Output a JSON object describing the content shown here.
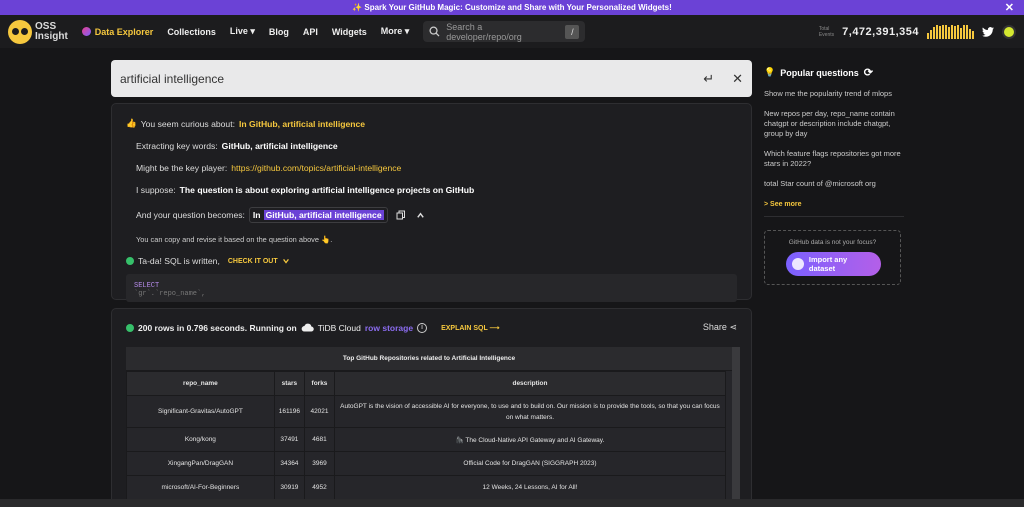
{
  "banner": {
    "text": "✨ Spark Your GitHub Magic: Customize and Share with Your Personalized Widgets!",
    "close": "✕"
  },
  "nav": {
    "logo_line1": "OSS",
    "logo_line2": "Insight",
    "items": [
      "Data Explorer",
      "Collections",
      "Live ▾",
      "Blog",
      "API",
      "Widgets",
      "More ▾"
    ],
    "search_placeholder": "Search a developer/repo/org",
    "search_shortcut": "/",
    "total_label_1": "Total",
    "total_label_2": "Events",
    "total_events": "7,472,391,354"
  },
  "query": {
    "text": "artificial intelligence",
    "enter": "↵",
    "clear": "✕"
  },
  "analysis": {
    "curious_prefix": "You seem curious about:",
    "curious_value": "In GitHub, artificial intelligence",
    "keywords_label": "Extracting key words:",
    "keywords_value": "GitHub, artificial intelligence",
    "player_label": "Might be the key player:",
    "player_value": "https://github.com/topics/artificial-intelligence",
    "suppose_label": "I suppose:",
    "suppose_value": "The question is about exploring artificial intelligence projects on GitHub",
    "becomes_label": "And your question becomes:",
    "becomes_in": "In",
    "becomes_value": "GitHub, artificial intelligence",
    "copy_hint": "You can copy and revise it based on the question above 👆.",
    "sql_written": "Ta-da! SQL is written,",
    "check_it_out": "CHECK IT OUT",
    "sql_line1": "SELECT",
    "sql_line2": "`gr`.`repo_name`,"
  },
  "result": {
    "summary": "200 rows in 0.796 seconds. Running on",
    "engine": "TiDB Cloud",
    "storage": "row storage",
    "explain": "EXPLAIN SQL ⟶",
    "share": "Share",
    "table_title": "Top GitHub Repositories related to Artificial Intelligence",
    "columns": [
      "repo_name",
      "stars",
      "forks",
      "description"
    ],
    "rows": [
      [
        "Significant-Gravitas/AutoGPT",
        "161196",
        "42021",
        "AutoGPT is the vision of accessible AI for everyone, to use and to build on. Our mission is to provide the tools, so that you can focus on what matters."
      ],
      [
        "Kong/kong",
        "37491",
        "4681",
        "🦍 The Cloud-Native API Gateway and AI Gateway."
      ],
      [
        "XingangPan/DragGAN",
        "34364",
        "3969",
        "Official Code for DragGAN (SIGGRAPH 2023)"
      ],
      [
        "microsoft/AI-For-Beginners",
        "30919",
        "4952",
        "12 Weeks, 24 Lessons, AI for All!"
      ]
    ]
  },
  "sidebar": {
    "title": "Popular questions",
    "questions": [
      "Show me the popularity trend of mlops",
      "New repos per day, repo_name contain chatgpt or description include chatgpt, group by day",
      "Which feature flags repositories got more stars in 2022?",
      "total Star count of @microsoft org"
    ],
    "see_more": "> See more",
    "import_hint": "GitHub data is not your focus?",
    "import_button": "Import any dataset"
  }
}
